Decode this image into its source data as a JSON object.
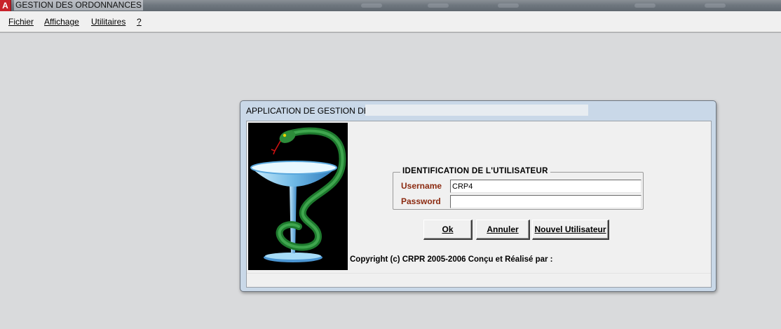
{
  "window": {
    "app_icon_letter": "A",
    "title": "GESTION DES ORDONNANCES"
  },
  "menu": {
    "items": [
      "Fichier",
      "Affichage",
      "Utilitaires",
      "?"
    ]
  },
  "dialog": {
    "title": "APPLICATION DE GESTION DES",
    "group_title": "IDENTIFICATION DE L'UTILISATEUR",
    "username_label": "Username",
    "username_value": "CRP4",
    "password_label": "Password",
    "password_value": "",
    "ok_label": "Ok",
    "cancel_label": "Annuler",
    "new_user_label": "Nouvel Utilisateur",
    "copyright": "Copyright (c) CRPR 2005-2006 Conçu et Réalisé par :"
  },
  "colors": {
    "label_color": "#8b2a10",
    "dialog_frame": "#c9d8e8",
    "logo_background": "#000000",
    "snake_green": "#1e7a2e"
  },
  "icons": {
    "logo": "pharmacy-bowl-of-hygieia-icon"
  }
}
